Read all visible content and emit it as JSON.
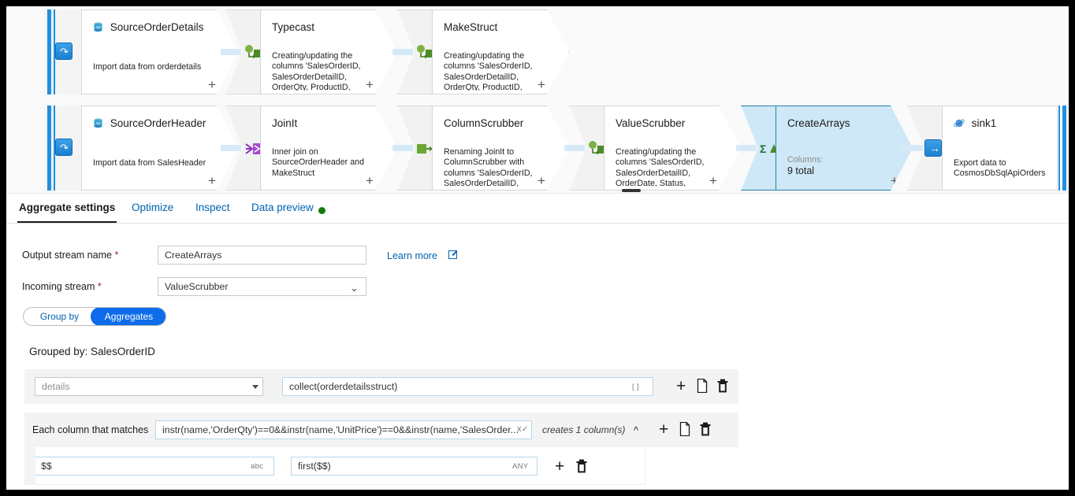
{
  "canvas": {
    "rows": [
      {
        "nodes": [
          {
            "kind": "source",
            "icon": "sql-database-icon",
            "title": "SourceOrderDetails",
            "desc": "Import data from orderdetails"
          },
          {
            "kind": "transform",
            "icon": "derived-column-icon",
            "title": "Typecast",
            "desc": "Creating/updating the columns 'SalesOrderID, SalesOrderDetailID, OrderQty, ProductID, UnitPrice,"
          },
          {
            "kind": "transform",
            "icon": "derived-column-icon",
            "title": "MakeStruct",
            "desc": "Creating/updating the columns 'SalesOrderID, SalesOrderDetailID, OrderQty, ProductID, UnitPrice,"
          }
        ]
      },
      {
        "nodes": [
          {
            "kind": "source",
            "icon": "sql-database-icon",
            "title": "SourceOrderHeader",
            "desc": "Import data from SalesHeader"
          },
          {
            "kind": "transform",
            "icon": "join-icon",
            "title": "JoinIt",
            "desc": "Inner join on SourceOrderHeader and MakeStruct"
          },
          {
            "kind": "transform",
            "icon": "select-icon",
            "title": "ColumnScrubber",
            "desc": "Renaming JoinIt to ColumnScrubber with columns 'SalesOrderID, SalesOrderDetailID, OrderDate,"
          },
          {
            "kind": "transform",
            "icon": "derived-column-icon",
            "title": "ValueScrubber",
            "desc": "Creating/updating the columns 'SalesOrderID, SalesOrderDetailID, OrderDate, Status, SalesOrderNumber,"
          },
          {
            "kind": "transform-selected",
            "icon": "aggregate-icon",
            "title": "CreateArrays",
            "sub": "Columns:",
            "value": "9 total"
          },
          {
            "kind": "sink",
            "icon": "cosmosdb-icon",
            "title": "sink1",
            "desc": "Export data to CosmosDbSqlApiOrders"
          }
        ]
      }
    ],
    "add_label": "+"
  },
  "tabs": {
    "items": [
      {
        "label": "Aggregate settings",
        "active": true
      },
      {
        "label": "Optimize",
        "active": false
      },
      {
        "label": "Inspect",
        "active": false
      },
      {
        "label": "Data preview",
        "active": false
      }
    ],
    "data_preview_status_color": "#107c10"
  },
  "settings": {
    "output_stream": {
      "label": "Output stream name",
      "required": "*",
      "value": "CreateArrays"
    },
    "incoming_stream": {
      "label": "Incoming stream",
      "required": "*",
      "value": "ValueScrubber"
    },
    "learn_more": "Learn more",
    "toggle": {
      "group_by": "Group by",
      "aggregates": "Aggregates",
      "selected": "Aggregates"
    },
    "grouped_by": "Grouped by: SalesOrderID"
  },
  "aggregates": {
    "row1": {
      "column_placeholder": "details",
      "expression": "collect(orderdetailsstruct)",
      "type_hint": "[ ]",
      "add_label": "+",
      "copy_label": "copy-icon",
      "delete_label": "delete-icon"
    },
    "pattern_row": {
      "label": "Each column that matches",
      "expression": "instr(name,'OrderQty')==0&&instr(name,'UnitPrice')==0&&instr(name,'SalesOrder...",
      "type_hint": "x",
      "creates": "creates 1 column(s)",
      "collapse_label": "collapse-icon",
      "add_label": "+"
    },
    "nested_row": {
      "name_expression": "$$",
      "name_type_hint": "abc",
      "value_expression": "first($$)",
      "value_type_hint": "ANY",
      "add_label": "+",
      "delete_label": "delete-icon"
    }
  }
}
